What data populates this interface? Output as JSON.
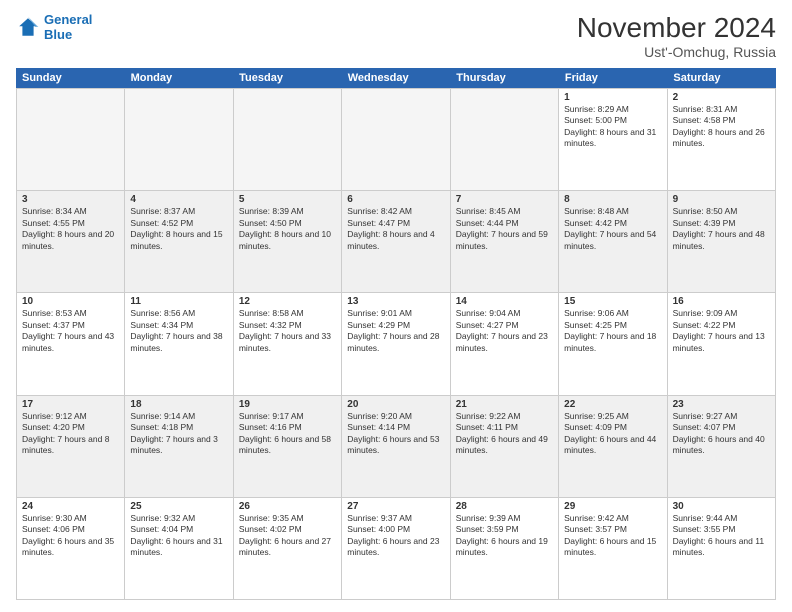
{
  "header": {
    "logo_line1": "General",
    "logo_line2": "Blue",
    "month": "November 2024",
    "location": "Ust'-Omchug, Russia"
  },
  "days_of_week": [
    "Sunday",
    "Monday",
    "Tuesday",
    "Wednesday",
    "Thursday",
    "Friday",
    "Saturday"
  ],
  "rows": [
    [
      {
        "day": "",
        "empty": true
      },
      {
        "day": "",
        "empty": true
      },
      {
        "day": "",
        "empty": true
      },
      {
        "day": "",
        "empty": true
      },
      {
        "day": "",
        "empty": true
      },
      {
        "day": "1",
        "info": "Sunrise: 8:29 AM\nSunset: 5:00 PM\nDaylight: 8 hours and 31 minutes."
      },
      {
        "day": "2",
        "info": "Sunrise: 8:31 AM\nSunset: 4:58 PM\nDaylight: 8 hours and 26 minutes."
      }
    ],
    [
      {
        "day": "3",
        "info": "Sunrise: 8:34 AM\nSunset: 4:55 PM\nDaylight: 8 hours and 20 minutes.",
        "shaded": true
      },
      {
        "day": "4",
        "info": "Sunrise: 8:37 AM\nSunset: 4:52 PM\nDaylight: 8 hours and 15 minutes.",
        "shaded": true
      },
      {
        "day": "5",
        "info": "Sunrise: 8:39 AM\nSunset: 4:50 PM\nDaylight: 8 hours and 10 minutes.",
        "shaded": true
      },
      {
        "day": "6",
        "info": "Sunrise: 8:42 AM\nSunset: 4:47 PM\nDaylight: 8 hours and 4 minutes.",
        "shaded": true
      },
      {
        "day": "7",
        "info": "Sunrise: 8:45 AM\nSunset: 4:44 PM\nDaylight: 7 hours and 59 minutes.",
        "shaded": true
      },
      {
        "day": "8",
        "info": "Sunrise: 8:48 AM\nSunset: 4:42 PM\nDaylight: 7 hours and 54 minutes.",
        "shaded": true
      },
      {
        "day": "9",
        "info": "Sunrise: 8:50 AM\nSunset: 4:39 PM\nDaylight: 7 hours and 48 minutes.",
        "shaded": true
      }
    ],
    [
      {
        "day": "10",
        "info": "Sunrise: 8:53 AM\nSunset: 4:37 PM\nDaylight: 7 hours and 43 minutes."
      },
      {
        "day": "11",
        "info": "Sunrise: 8:56 AM\nSunset: 4:34 PM\nDaylight: 7 hours and 38 minutes."
      },
      {
        "day": "12",
        "info": "Sunrise: 8:58 AM\nSunset: 4:32 PM\nDaylight: 7 hours and 33 minutes."
      },
      {
        "day": "13",
        "info": "Sunrise: 9:01 AM\nSunset: 4:29 PM\nDaylight: 7 hours and 28 minutes."
      },
      {
        "day": "14",
        "info": "Sunrise: 9:04 AM\nSunset: 4:27 PM\nDaylight: 7 hours and 23 minutes."
      },
      {
        "day": "15",
        "info": "Sunrise: 9:06 AM\nSunset: 4:25 PM\nDaylight: 7 hours and 18 minutes."
      },
      {
        "day": "16",
        "info": "Sunrise: 9:09 AM\nSunset: 4:22 PM\nDaylight: 7 hours and 13 minutes."
      }
    ],
    [
      {
        "day": "17",
        "info": "Sunrise: 9:12 AM\nSunset: 4:20 PM\nDaylight: 7 hours and 8 minutes.",
        "shaded": true
      },
      {
        "day": "18",
        "info": "Sunrise: 9:14 AM\nSunset: 4:18 PM\nDaylight: 7 hours and 3 minutes.",
        "shaded": true
      },
      {
        "day": "19",
        "info": "Sunrise: 9:17 AM\nSunset: 4:16 PM\nDaylight: 6 hours and 58 minutes.",
        "shaded": true
      },
      {
        "day": "20",
        "info": "Sunrise: 9:20 AM\nSunset: 4:14 PM\nDaylight: 6 hours and 53 minutes.",
        "shaded": true
      },
      {
        "day": "21",
        "info": "Sunrise: 9:22 AM\nSunset: 4:11 PM\nDaylight: 6 hours and 49 minutes.",
        "shaded": true
      },
      {
        "day": "22",
        "info": "Sunrise: 9:25 AM\nSunset: 4:09 PM\nDaylight: 6 hours and 44 minutes.",
        "shaded": true
      },
      {
        "day": "23",
        "info": "Sunrise: 9:27 AM\nSunset: 4:07 PM\nDaylight: 6 hours and 40 minutes.",
        "shaded": true
      }
    ],
    [
      {
        "day": "24",
        "info": "Sunrise: 9:30 AM\nSunset: 4:06 PM\nDaylight: 6 hours and 35 minutes."
      },
      {
        "day": "25",
        "info": "Sunrise: 9:32 AM\nSunset: 4:04 PM\nDaylight: 6 hours and 31 minutes."
      },
      {
        "day": "26",
        "info": "Sunrise: 9:35 AM\nSunset: 4:02 PM\nDaylight: 6 hours and 27 minutes."
      },
      {
        "day": "27",
        "info": "Sunrise: 9:37 AM\nSunset: 4:00 PM\nDaylight: 6 hours and 23 minutes."
      },
      {
        "day": "28",
        "info": "Sunrise: 9:39 AM\nSunset: 3:59 PM\nDaylight: 6 hours and 19 minutes."
      },
      {
        "day": "29",
        "info": "Sunrise: 9:42 AM\nSunset: 3:57 PM\nDaylight: 6 hours and 15 minutes."
      },
      {
        "day": "30",
        "info": "Sunrise: 9:44 AM\nSunset: 3:55 PM\nDaylight: 6 hours and 11 minutes."
      }
    ]
  ]
}
